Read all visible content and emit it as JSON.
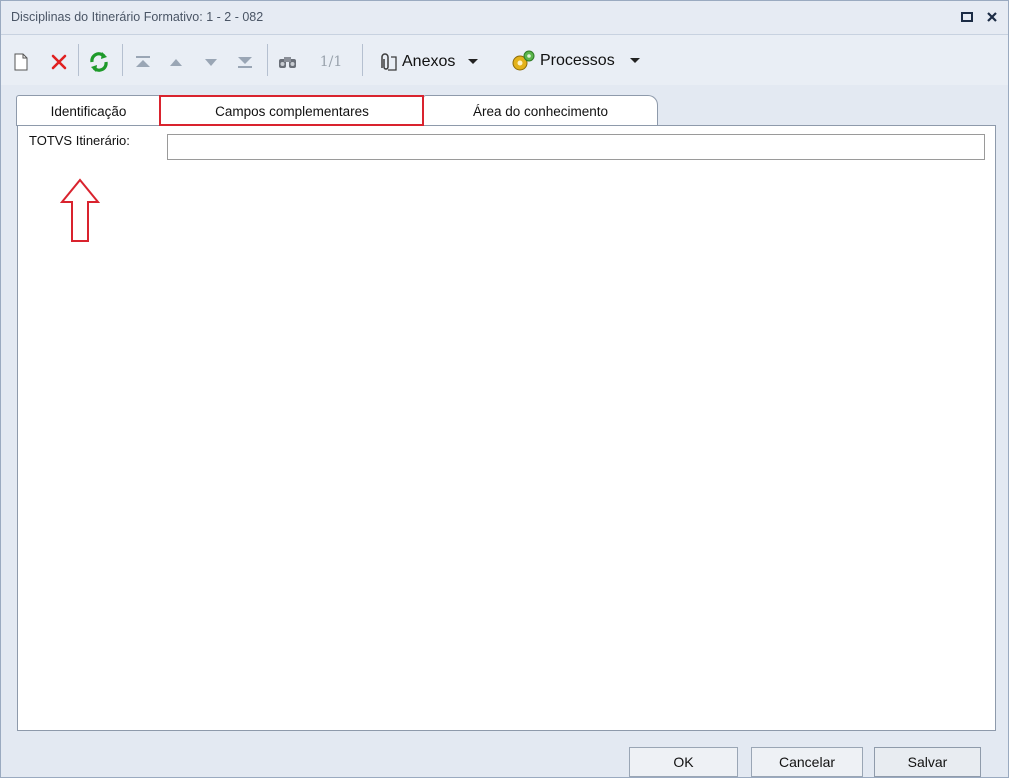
{
  "window": {
    "title": "Disciplinas do Itinerário Formativo: 1 - 2 - 082"
  },
  "title_buttons": {
    "restore_icon": "restore-icon",
    "close_icon": "close-icon"
  },
  "toolbar": {
    "icons": [
      "new-document-icon",
      "delete-icon",
      "refresh-icon",
      "first-record-icon",
      "previous-record-icon",
      "next-record-icon",
      "last-record-icon",
      "search-icon"
    ],
    "pager": "1/1",
    "attachments_label": "Anexos",
    "processes_label": "Processos"
  },
  "tabs": [
    {
      "label": "Identificação"
    },
    {
      "label": "Campos complementares"
    },
    {
      "label": "Área do conhecimento"
    }
  ],
  "form": {
    "itinerary_label": "TOTVS Itinerário:",
    "itinerary_value": ""
  },
  "buttons": {
    "ok": "OK",
    "cancel": "Cancelar",
    "save": "Salvar"
  },
  "colors": {
    "highlight": "#d9232e",
    "delete_icon": "#e02020",
    "refresh_icon": "#1e9a2a"
  }
}
